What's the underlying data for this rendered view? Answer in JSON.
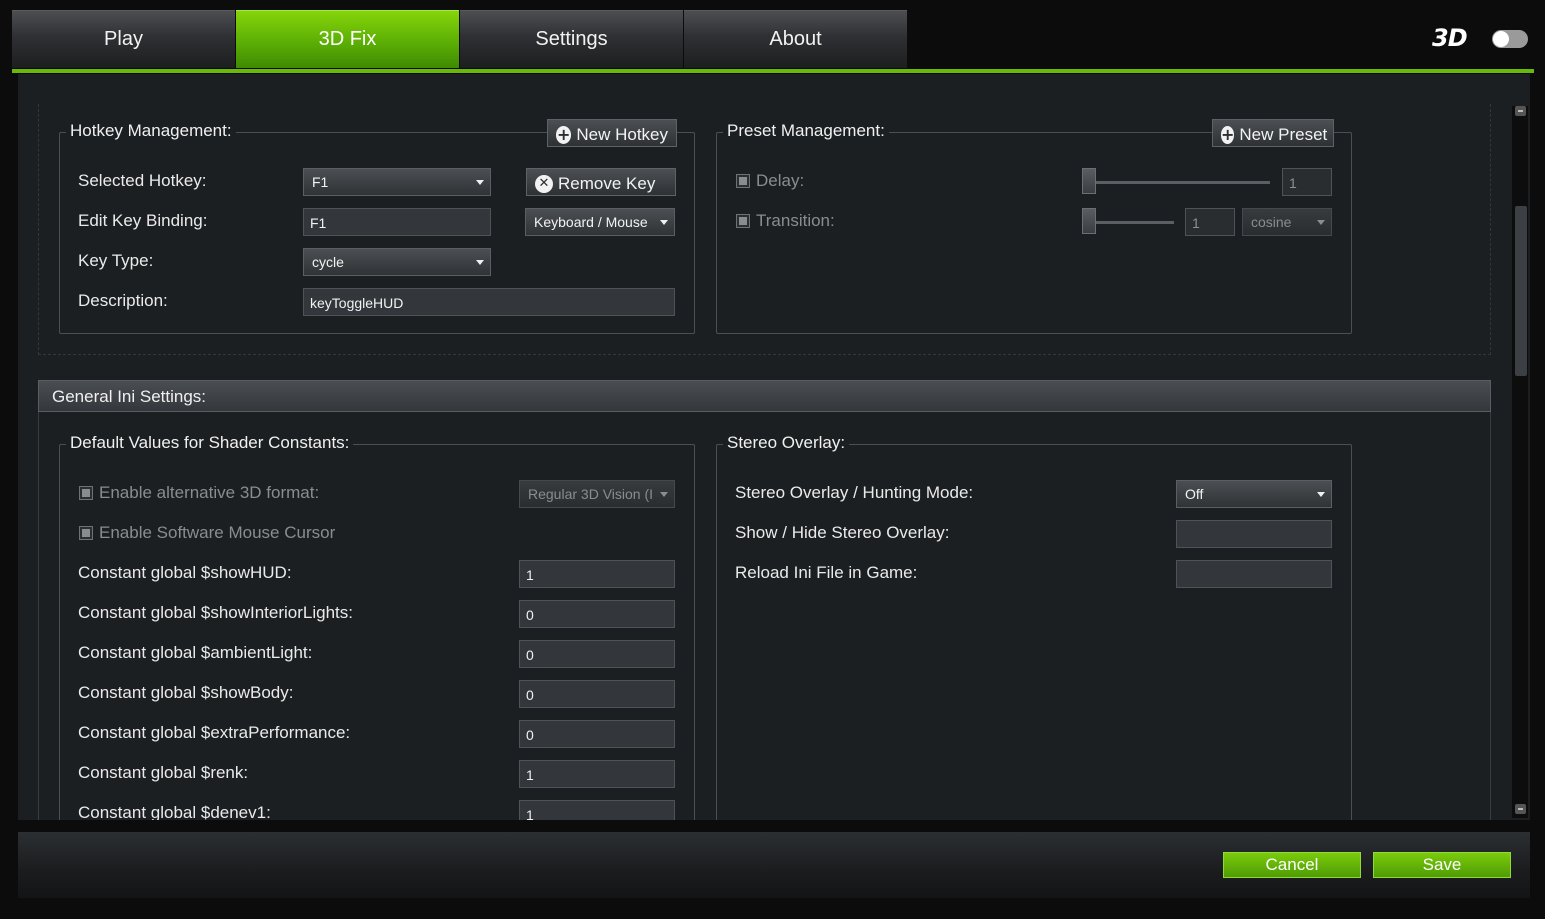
{
  "tabs": [
    {
      "label": "Play",
      "active": false
    },
    {
      "label": "3D Fix",
      "active": true
    },
    {
      "label": "Settings",
      "active": false
    },
    {
      "label": "About",
      "active": false
    }
  ],
  "logo": {
    "text": "3D"
  },
  "hotkey": {
    "legend": "Hotkey Management:",
    "new_hotkey_label": "New Hotkey",
    "remove_key_label": "Remove Key",
    "selected_hotkey_label": "Selected Hotkey:",
    "selected_hotkey_value": "F1",
    "edit_binding_label": "Edit Key Binding:",
    "edit_binding_value": "F1",
    "input_device_value": "Keyboard / Mouse",
    "key_type_label": "Key Type:",
    "key_type_value": "cycle",
    "description_label": "Description:",
    "description_value": "keyToggleHUD"
  },
  "preset": {
    "legend": "Preset Management:",
    "new_preset_label": "New Preset",
    "delay_label": "Delay:",
    "delay_value": "1",
    "transition_label": "Transition:",
    "transition_value": "1",
    "transition_curve": "cosine"
  },
  "general": {
    "header": "General Ini Settings:",
    "shader_legend": "Default Values for Shader Constants:",
    "alt_3d_label": "Enable alternative 3D format:",
    "alt_3d_value": "Regular 3D Vision (I",
    "soft_cursor_label": "Enable Software Mouse Cursor",
    "constants": [
      {
        "label": "Constant global $showHUD:",
        "value": "1"
      },
      {
        "label": "Constant global $showInteriorLights:",
        "value": "0"
      },
      {
        "label": "Constant global $ambientLight:",
        "value": "0"
      },
      {
        "label": "Constant global $showBody:",
        "value": "0"
      },
      {
        "label": "Constant global $extraPerformance:",
        "value": "0"
      },
      {
        "label": "Constant global $renk:",
        "value": "1"
      },
      {
        "label": "Constant global $denev1:",
        "value": "1"
      }
    ],
    "overlay_legend": "Stereo Overlay:",
    "overlay_mode_label": "Stereo Overlay / Hunting Mode:",
    "overlay_mode_value": "Off",
    "show_hide_label": "Show / Hide Stereo Overlay:",
    "show_hide_value": "",
    "reload_label": "Reload Ini File in Game:",
    "reload_value": ""
  },
  "footer": {
    "cancel_label": "Cancel",
    "save_label": "Save"
  },
  "colors": {
    "accent": "#6ab80a",
    "panel": "#1c1f22",
    "background": "#0c0c0c"
  }
}
